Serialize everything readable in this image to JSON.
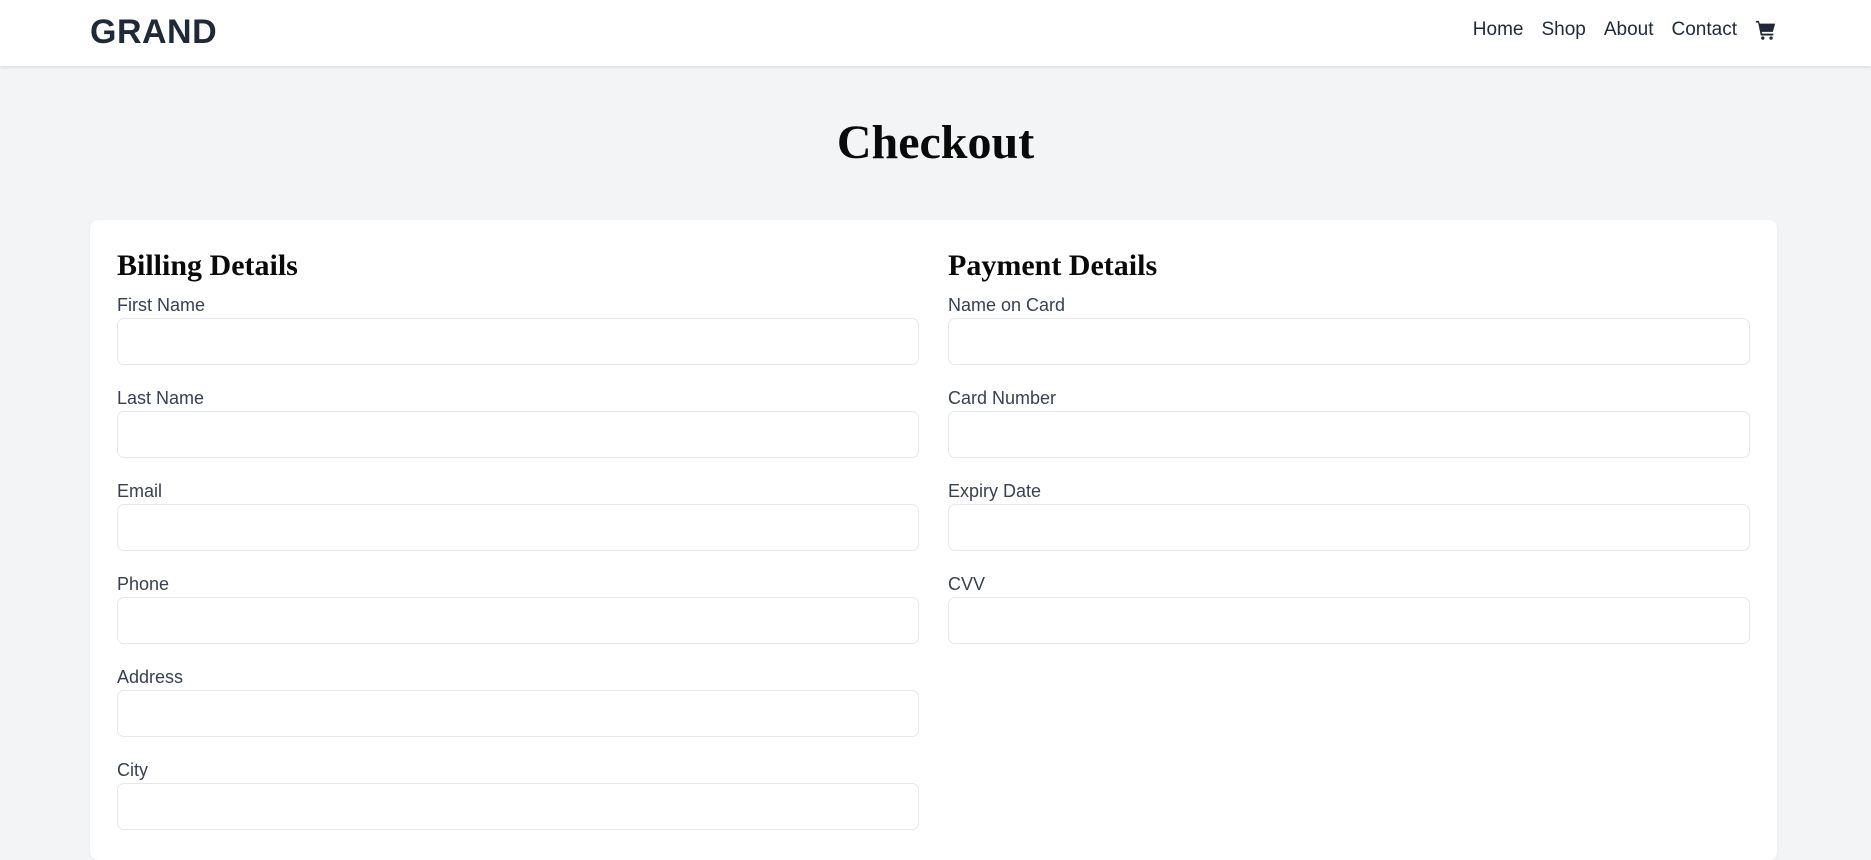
{
  "header": {
    "brand": "GRAND",
    "nav": [
      "Home",
      "Shop",
      "About",
      "Contact"
    ],
    "cart_icon": "cart-icon"
  },
  "page": {
    "title": "Checkout"
  },
  "billing": {
    "title": "Billing Details",
    "fields": [
      {
        "label": "First Name",
        "value": "",
        "placeholder": ""
      },
      {
        "label": "Last Name",
        "value": "",
        "placeholder": ""
      },
      {
        "label": "Email",
        "value": "",
        "placeholder": ""
      },
      {
        "label": "Phone",
        "value": "",
        "placeholder": ""
      },
      {
        "label": "Address",
        "value": "",
        "placeholder": ""
      },
      {
        "label": "City",
        "value": "",
        "placeholder": ""
      }
    ]
  },
  "payment": {
    "title": "Payment Details",
    "fields": [
      {
        "label": "Name on Card",
        "value": "",
        "placeholder": ""
      },
      {
        "label": "Card Number",
        "value": "",
        "placeholder": ""
      },
      {
        "label": "Expiry Date",
        "value": "",
        "placeholder": ""
      },
      {
        "label": "CVV",
        "value": "",
        "placeholder": ""
      }
    ]
  },
  "colors": {
    "page_bg": "#f3f4f6",
    "text": "#1f2937",
    "heading": "#0a0a0a",
    "input_border": "#e5e7eb"
  }
}
